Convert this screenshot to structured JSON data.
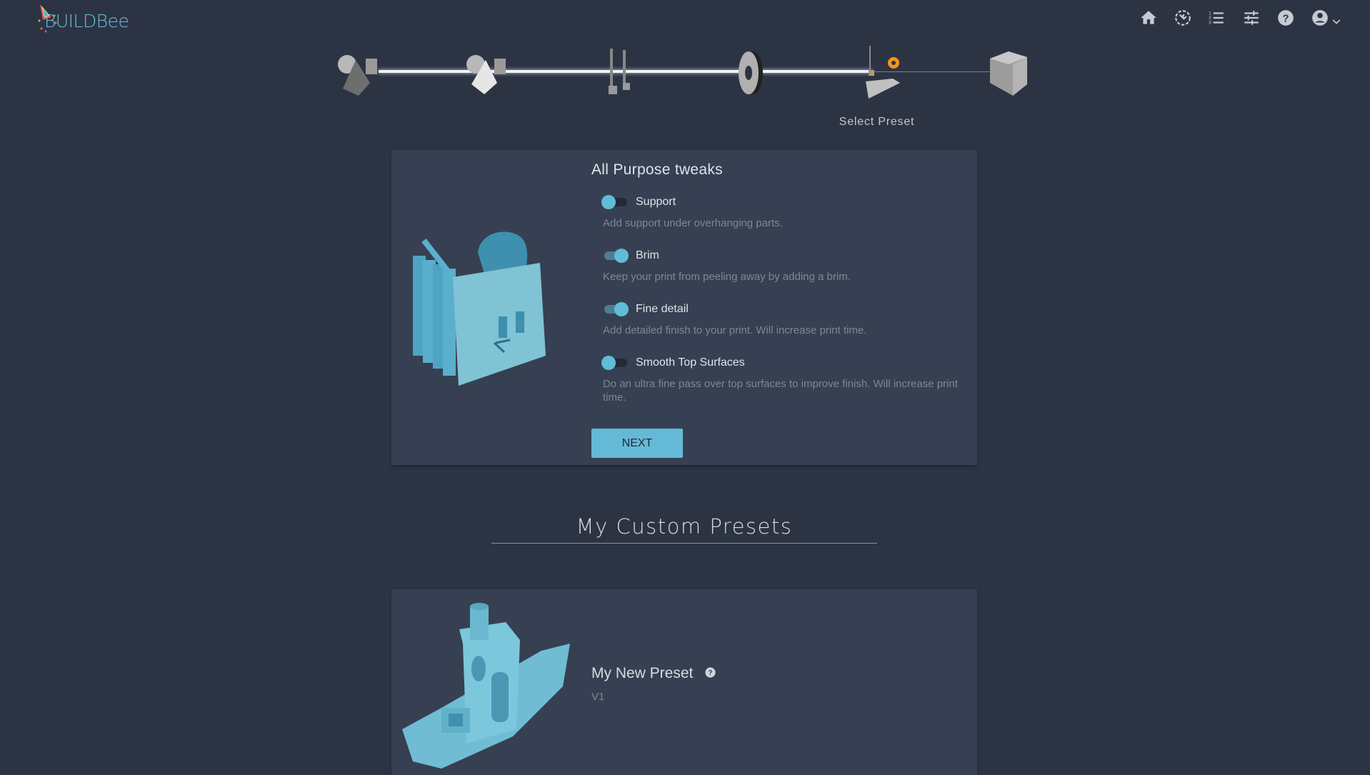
{
  "header": {
    "logo_text": "BUILDBee",
    "nav_icons": [
      "home-icon",
      "maintenance-icon",
      "list-numbered-icon",
      "sliders-icon",
      "help-icon",
      "account-icon"
    ]
  },
  "stepper": {
    "current_step_label": "Select Preset",
    "steps": [
      "models",
      "arrange",
      "printer",
      "material",
      "preset",
      "slice"
    ],
    "accent_color": "#f7931e"
  },
  "tweaks": {
    "title": "All Purpose tweaks",
    "options": [
      {
        "label": "Support",
        "description": "Add support under overhanging parts.",
        "enabled": false
      },
      {
        "label": "Brim",
        "description": "Keep your print from peeling away by adding a brim.",
        "enabled": true
      },
      {
        "label": "Fine detail",
        "description": "Add detailed finish to your print. Will increase print time.",
        "enabled": true
      },
      {
        "label": "Smooth Top Surfaces",
        "description": "Do an ultra fine pass over top surfaces to improve finish. Will increase print time.",
        "enabled": false
      }
    ],
    "next_label": "NEXT"
  },
  "custom_presets": {
    "title": "My Custom Presets",
    "items": [
      {
        "name": "My New Preset",
        "version": "V1"
      }
    ]
  },
  "colors": {
    "background": "#2c3444",
    "card": "#364052",
    "accent": "#64bad6"
  }
}
